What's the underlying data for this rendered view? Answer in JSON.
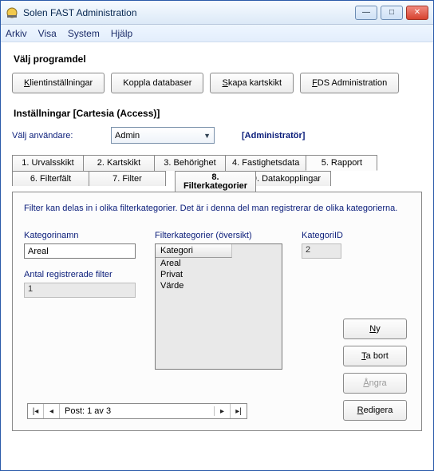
{
  "window": {
    "title": "Solen FAST Administration"
  },
  "menu": {
    "arkiv": "Arkiv",
    "visa": "Visa",
    "system": "System",
    "hjalp": "Hjälp"
  },
  "section1": {
    "heading": "Välj programdel",
    "btn_klient_pre": "K",
    "btn_klient_rest": "lientinställningar",
    "btn_koppla": "Koppla databaser",
    "btn_skapa_pre": "S",
    "btn_skapa_rest": "kapa kartskikt",
    "btn_fds_pre": "F",
    "btn_fds_rest": "DS Administration"
  },
  "section2": {
    "heading": "Inställningar [Cartesia (Access)]",
    "user_label": "Välj användare:",
    "user_value": "Admin",
    "admin_label": "[Administratör]"
  },
  "tabs": {
    "r1": [
      "1. Urvalsskikt",
      "2. Kartskikt",
      "3. Behörighet",
      "4. Fastighetsdata",
      "5. Rapport"
    ],
    "r2": [
      "6. Filterfält",
      "7. Filter",
      "",
      "9. Datakopplingar"
    ],
    "r3_pre": "8.",
    "r3_rest": "Filterkategorier"
  },
  "panel": {
    "desc": "Filter kan delas in i olika filterkategorier. Det är i denna del man registrerar de olika kategorierna.",
    "kategorinamn_label": "Kategorinamn",
    "kategorinamn_value": "Areal",
    "antal_label": "Antal registrerade filter",
    "antal_value": "1",
    "list_label": "Filterkategorier (översikt)",
    "list_header": "Kategori",
    "list_items": [
      "Areal",
      "Privat",
      "Värde"
    ],
    "kategoriid_label": "KategoriID",
    "kategoriid_value": "2",
    "btn_ny_pre": "N",
    "btn_ny_rest": "y",
    "btn_tabort_pre": "T",
    "btn_tabort_rest": "a bort",
    "btn_angra_pre": "Å",
    "btn_angra_rest": "ngra",
    "btn_redigera_pre": "R",
    "btn_redigera_rest": "edigera",
    "recnav": "Post: 1 av 3"
  },
  "winbtn": {
    "min": "—",
    "max": "□",
    "close": "✕"
  }
}
